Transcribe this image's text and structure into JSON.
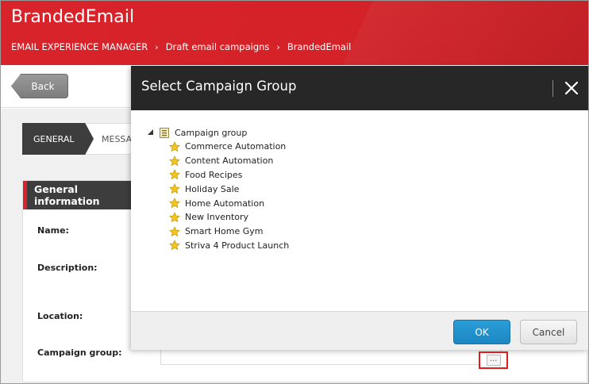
{
  "app": {
    "title": "BrandedEmail"
  },
  "breadcrumb": [
    "EMAIL EXPERIENCE MANAGER",
    "Draft email campaigns",
    "BrandedEmail"
  ],
  "toolbar": {
    "back_label": "Back"
  },
  "tabs": {
    "general": "GENERAL",
    "message": "MESSAGE"
  },
  "panel": {
    "title": "General information",
    "labels": {
      "name": "Name:",
      "description": "Description:",
      "location": "Location:",
      "campaign_group": "Campaign group:"
    },
    "browse_label": "..."
  },
  "dialog": {
    "title": "Select Campaign Group",
    "tree": {
      "root": "Campaign group",
      "items": [
        "Commerce Automation",
        "Content Automation",
        "Food Recipes",
        "Holiday Sale",
        "Home Automation",
        "New Inventory",
        "Smart Home Gym",
        "Striva 4 Product Launch"
      ]
    },
    "ok_label": "OK",
    "cancel_label": "Cancel"
  },
  "colors": {
    "brand_red": "#d9232a",
    "dark_header": "#272727",
    "primary_blue": "#1c86c2",
    "star_yellow": "#f2c61f",
    "highlight_red": "#e11c1c"
  }
}
